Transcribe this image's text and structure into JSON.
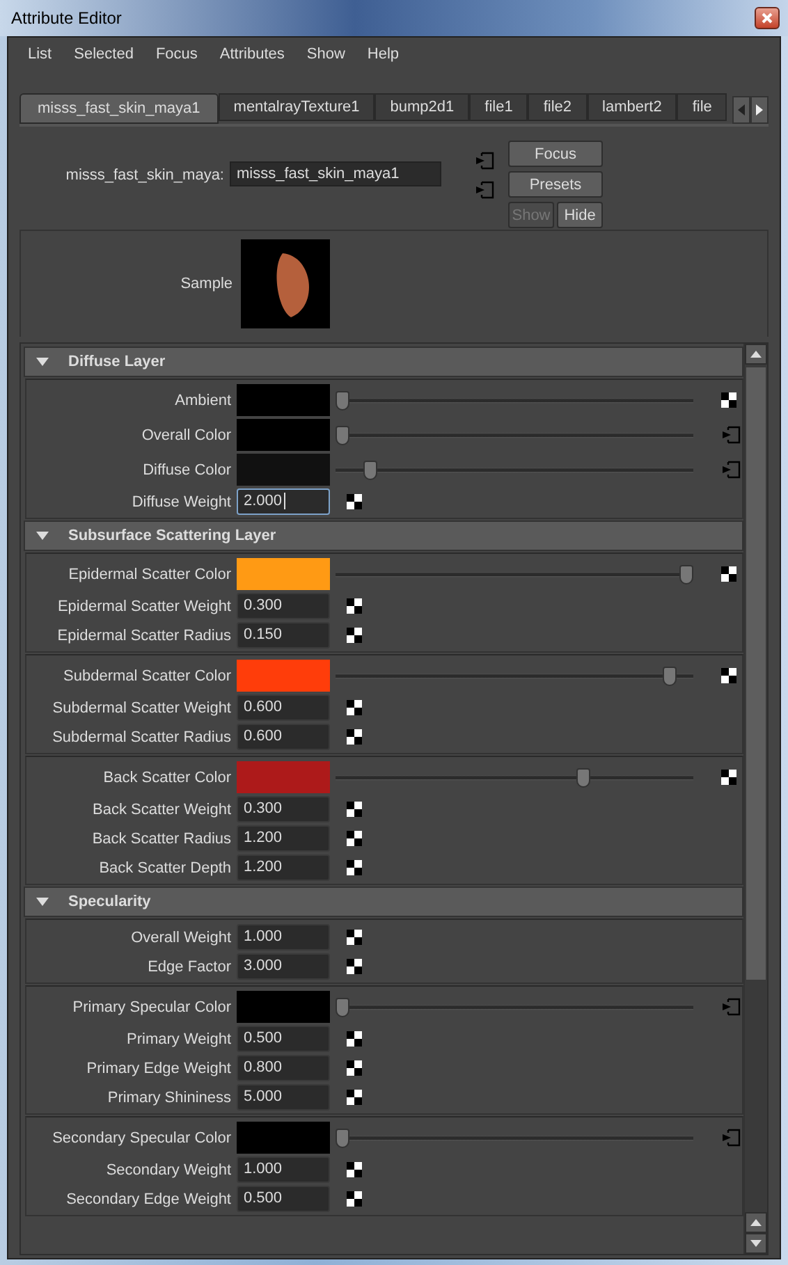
{
  "window": {
    "title": "Attribute Editor"
  },
  "menu": [
    "List",
    "Selected",
    "Focus",
    "Attributes",
    "Show",
    "Help"
  ],
  "tabs": [
    {
      "label": "misss_fast_skin_maya1",
      "selected": true
    },
    {
      "label": "mentalrayTexture1",
      "selected": false
    },
    {
      "label": "bump2d1",
      "selected": false
    },
    {
      "label": "file1",
      "selected": false
    },
    {
      "label": "file2",
      "selected": false
    },
    {
      "label": "lambert2",
      "selected": false
    },
    {
      "label": "file",
      "selected": false
    }
  ],
  "node": {
    "label": "misss_fast_skin_maya:",
    "value": "misss_fast_skin_maya1"
  },
  "buttons": [
    {
      "label": "Focus",
      "disabled": false
    },
    {
      "label": "Presets",
      "disabled": false
    }
  ],
  "small_buttons": [
    {
      "label": "Show",
      "disabled": true
    },
    {
      "label": "Hide",
      "disabled": false
    }
  ],
  "sample": {
    "label": "Sample"
  },
  "sections": [
    {
      "title": "Diffuse Layer",
      "expanded": true,
      "groups": [
        [
          {
            "kind": "color",
            "label": "Ambient",
            "color": "#000000",
            "level": 0,
            "connected": false
          },
          {
            "kind": "color",
            "label": "Overall Color",
            "color": "#000000",
            "level": 0,
            "connected": true
          },
          {
            "kind": "color",
            "label": "Diffuse Color",
            "color": "#111111",
            "level": 0.08,
            "connected": true
          },
          {
            "kind": "number",
            "label": "Diffuse Weight",
            "value": "2.000",
            "focused": true
          }
        ]
      ]
    },
    {
      "title": "Subsurface Scattering Layer",
      "expanded": true,
      "groups": [
        [
          {
            "kind": "color",
            "label": "Epidermal Scatter Color",
            "color": "#ff9a14",
            "level": 1,
            "connected": false
          },
          {
            "kind": "number",
            "label": "Epidermal Scatter Weight",
            "value": "0.300",
            "focused": false
          },
          {
            "kind": "number",
            "label": "Epidermal Scatter Radius",
            "value": "0.150",
            "focused": false
          }
        ],
        [
          {
            "kind": "color",
            "label": "Subdermal Scatter Color",
            "color": "#ff3d0a",
            "level": 0.95,
            "connected": false
          },
          {
            "kind": "number",
            "label": "Subdermal Scatter Weight",
            "value": "0.600",
            "focused": false
          },
          {
            "kind": "number",
            "label": "Subdermal Scatter Radius",
            "value": "0.600",
            "focused": false
          }
        ],
        [
          {
            "kind": "color",
            "label": "Back Scatter Color",
            "color": "#ad1a1a",
            "level": 0.7,
            "connected": false
          },
          {
            "kind": "number",
            "label": "Back Scatter Weight",
            "value": "0.300",
            "focused": false
          },
          {
            "kind": "number",
            "label": "Back Scatter Radius",
            "value": "1.200",
            "focused": false
          },
          {
            "kind": "number",
            "label": "Back Scatter Depth",
            "value": "1.200",
            "focused": false
          }
        ]
      ]
    },
    {
      "title": "Specularity",
      "expanded": true,
      "groups": [
        [
          {
            "kind": "number",
            "label": "Overall Weight",
            "value": "1.000",
            "focused": false
          },
          {
            "kind": "number",
            "label": "Edge Factor",
            "value": "3.000",
            "focused": false
          }
        ],
        [
          {
            "kind": "color",
            "label": "Primary Specular Color",
            "color": "#000000",
            "level": 0,
            "connected": true
          },
          {
            "kind": "number",
            "label": "Primary Weight",
            "value": "0.500",
            "focused": false
          },
          {
            "kind": "number",
            "label": "Primary Edge Weight",
            "value": "0.800",
            "focused": false
          },
          {
            "kind": "number",
            "label": "Primary Shininess",
            "value": "5.000",
            "focused": false
          }
        ],
        [
          {
            "kind": "color",
            "label": "Secondary Specular Color",
            "color": "#000000",
            "level": 0,
            "connected": true
          },
          {
            "kind": "number",
            "label": "Secondary Weight",
            "value": "1.000",
            "focused": false
          },
          {
            "kind": "number",
            "label": "Secondary Edge Weight",
            "value": "0.500",
            "focused": false
          }
        ]
      ]
    }
  ]
}
